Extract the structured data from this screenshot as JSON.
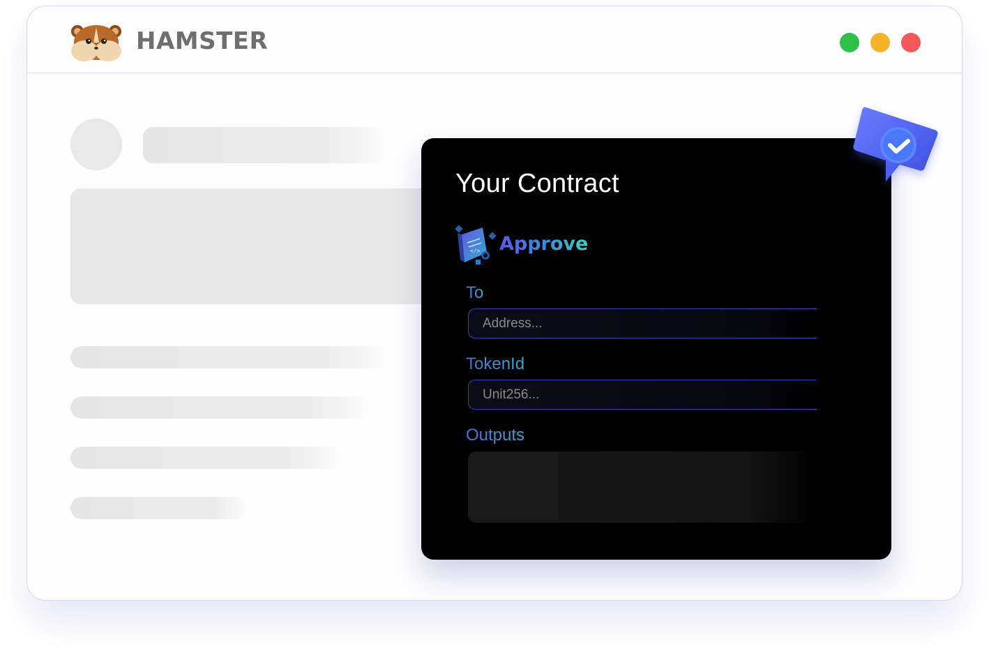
{
  "app": {
    "brand": "HAMSTER",
    "logo_icon": "hamster-logo-icon"
  },
  "window_controls": {
    "green": "#2fc04a",
    "yellow": "#f6b42b",
    "red": "#f25a5a"
  },
  "contract_panel": {
    "title": "Your Contract",
    "function": {
      "icon": "contract-cube-icon",
      "name": "Approve"
    },
    "fields": {
      "to": {
        "label": "To",
        "placeholder": "Address..."
      },
      "token_id": {
        "label": "TokenId",
        "placeholder": "Unit256..."
      }
    },
    "outputs": {
      "label": "Outputs"
    }
  },
  "badge": {
    "icon": "verified-check-icon",
    "color": "#4f6bf0"
  },
  "colors": {
    "accent_gradient_start": "#5b57f0",
    "accent_gradient_end": "#3fd1c6",
    "input_border": "#3b3fb8",
    "panel_background": "#000000"
  }
}
